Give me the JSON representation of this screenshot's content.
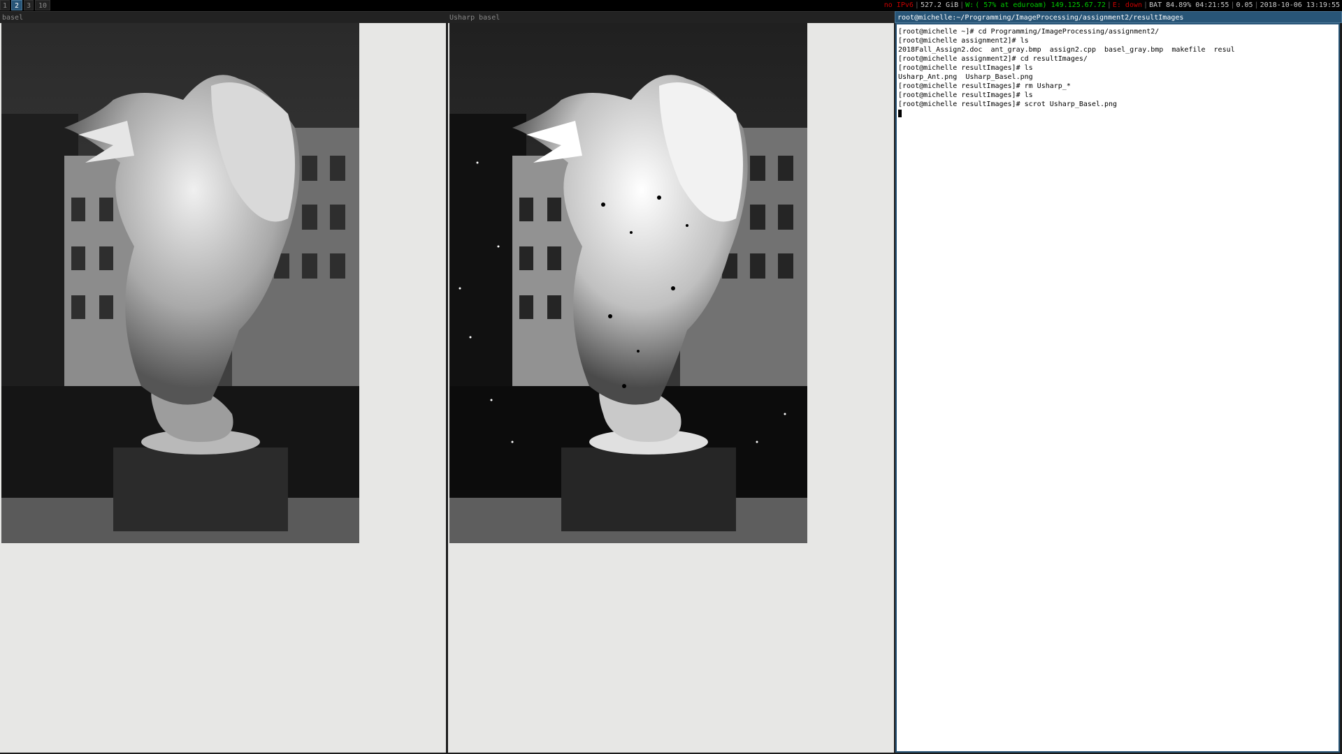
{
  "bar": {
    "workspaces": [
      {
        "label": "1",
        "focused": false
      },
      {
        "label": "2",
        "focused": true
      },
      {
        "label": "3",
        "focused": false
      },
      {
        "label": "10",
        "focused": false
      }
    ],
    "status": {
      "ipv6": "no IPv6",
      "disk": "527.2 GiB",
      "wifi_prefix": "W:",
      "wifi_info": "( 57% at eduroam) 149.125.67.72",
      "ethernet": "E: down",
      "battery": "BAT 84.89% 04:21:55",
      "load": "0.05",
      "datetime": "2018-10-06 13:19:55"
    },
    "colors": {
      "good": "#00cc00",
      "bad": "#cc0000",
      "text": "#cfcfcf"
    }
  },
  "windows": {
    "left": {
      "title": "basel"
    },
    "middle": {
      "title": "Usharp basel"
    },
    "terminal": {
      "title": "root@michelle:~/Programming/ImageProcessing/assignment2/resultImages",
      "lines": [
        "[root@michelle ~]# cd Programming/ImageProcessing/assignment2/",
        "[root@michelle assignment2]# ls",
        "2018Fall_Assign2.doc  ant_gray.bmp  assign2.cpp  basel_gray.bmp  makefile  resul",
        "[root@michelle assignment2]# cd resultImages/",
        "[root@michelle resultImages]# ls",
        "Usharp_Ant.png  Usharp_Basel.png",
        "[root@michelle resultImages]# rm Usharp_*",
        "[root@michelle resultImages]# ls",
        "[root@michelle resultImages]# scrot Usharp_Basel.png"
      ]
    }
  },
  "colors": {
    "focused_title_bg": "#285577",
    "viewer_bg": "#e7e7e5",
    "terminal_bg": "#ffffff"
  }
}
